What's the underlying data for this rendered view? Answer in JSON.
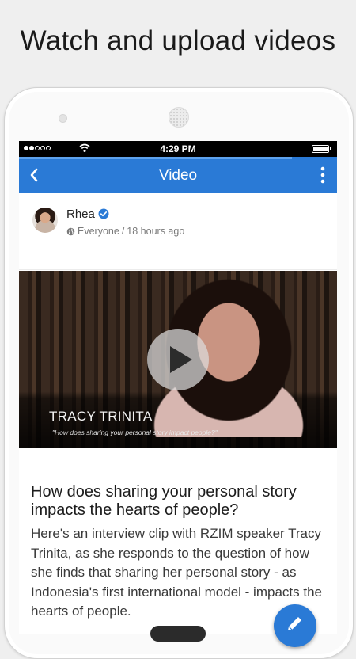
{
  "promo": {
    "heading": "Watch and upload videos"
  },
  "status_bar": {
    "time": "4:29 PM",
    "signal_bars_filled": 2,
    "signal_bars_total": 5
  },
  "app_bar": {
    "title": "Video",
    "accent_color": "#2a7ad6"
  },
  "post": {
    "author": "Rhea",
    "verified": true,
    "audience": "Everyone",
    "separator": "/",
    "time_ago": "18 hours ago",
    "video": {
      "lower_third": "TRACY TRINITA",
      "caption": "\"How does sharing your personal story impact people?\""
    },
    "title": "How does sharing your personal story impacts the hearts of people?",
    "body": "Here's an interview clip with RZIM speaker Tracy Trinita, as she responds to the question of how she finds that sharing her personal story - as Indonesia's first international model - impacts the hearts of people."
  },
  "icons": {
    "back": "chevron-left-icon",
    "more": "more-vertical-icon",
    "verified": "verified-check-icon",
    "audience": "globe-icon",
    "play": "play-icon",
    "compose": "pencil-icon"
  }
}
